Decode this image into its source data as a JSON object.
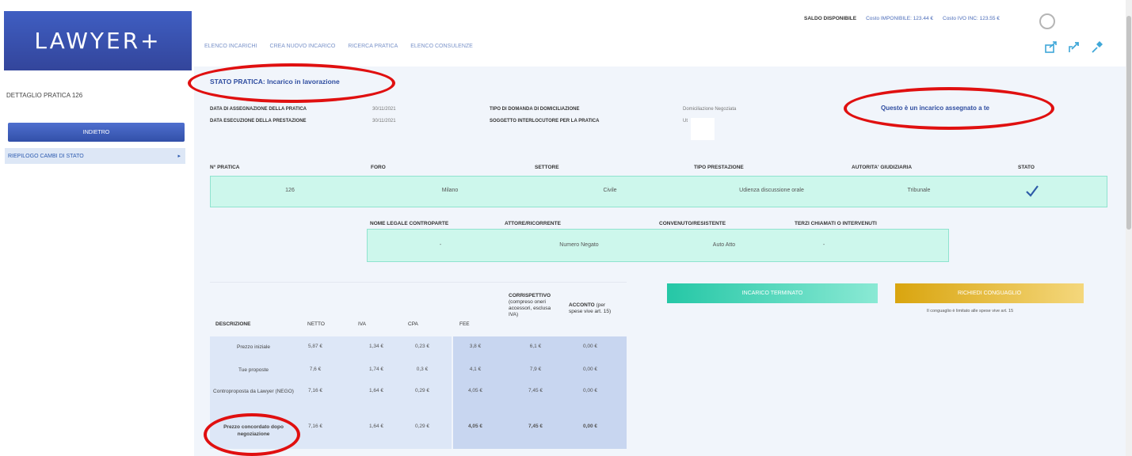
{
  "app": {
    "logo_text": "LAWYER+"
  },
  "sidebar": {
    "title": "DETTAGLIO PRATICA 126",
    "back_button": "INDIETRO",
    "item_label": "RIEPILOGO CAMBI DI STATO",
    "item_chevron": "▸"
  },
  "topnav": [
    "ELENCO INCARICHI",
    "CREA NUOVO INCARICO",
    "RICERCA PRATICA",
    "ELENCO CONSULENZE"
  ],
  "balance": {
    "label": "SALDO DISPONIBILE",
    "tax_label": "Costo IMPONIBILE: 123.44 €",
    "total_label": "Costo IVO INC: 123.55 €"
  },
  "status": {
    "title": "STATO PRATICA: Incarico in lavorazione",
    "assigned": "Questo è un incarico assegnato a te"
  },
  "info": {
    "date_label": "DATA DI ASSEGNAZIONE DELLA PRATICA",
    "date_value": "30/11/2021",
    "exec_label": "DATA ESECUZIONE DELLA PRESTAZIONE",
    "exec_value": "30/11/2021",
    "request_label": "TIPO DI DOMANDA DI DOMICILIAZIONE",
    "request_value": "Domiciliazione Negoziata",
    "subject_label": "SOGGETTO INTERLOCUTORE PER LA PRATICA",
    "subject_value": "Ut"
  },
  "case_table": {
    "headers": [
      "N° PRATICA",
      "FORO",
      "SETTORE",
      "TIPO PRESTAZIONE",
      "AUTORITA' GIUDIZIARIA",
      "STATO"
    ],
    "row": [
      "126",
      "Milano",
      "Civile",
      "Udienza discussione orale",
      "Tribunale",
      "✓"
    ]
  },
  "parties_table": {
    "headers": [
      "NOME LEGALE CONTROPARTE",
      "ATTORE/RICORRENTE",
      "CONVENUTO/RESISTENTE",
      "TERZI CHIAMATI O INTERVENUTI"
    ],
    "row": [
      "-",
      "Numero Negato",
      "Auto Atto",
      "-"
    ]
  },
  "actions": {
    "completed_button": "INCARICO TERMINATO",
    "conguaglio_button": "RICHIEDI CONGUAGLIO",
    "conguaglio_note": "Il conguaglio è limitato alle spese vive art. 15"
  },
  "price_table": {
    "headers": {
      "descrizione": "DESCRIZIONE",
      "netto": "NETTO",
      "iva": "IVA",
      "cpa": "CPA",
      "fee": "FEE",
      "corrispettivo_title": "CORRISPETTIVO",
      "corrispettivo_sub": "(compreso oneri accessori, esclusa IVA)",
      "acconto_title": "ACCONTO",
      "acconto_sub": "(per spese vive art. 15)"
    },
    "rows": [
      {
        "desc": "Prezzo iniziale",
        "netto": "5,87 €",
        "iva": "1,34 €",
        "cpa": "0,23 €",
        "fee": "3,8 €",
        "corr": "6,1 €",
        "acc": "0,00 €"
      },
      {
        "desc": "Tue proposte",
        "netto": "7,6 €",
        "iva": "1,74 €",
        "cpa": "0,3 €",
        "fee": "4,1 €",
        "corr": "7,9 €",
        "acc": "0,00 €"
      },
      {
        "desc": "Controproposta da Lawyer (NEGO)",
        "netto": "7,16 €",
        "iva": "1,64 €",
        "cpa": "0,29 €",
        "fee": "4,05 €",
        "corr": "7,45 €",
        "acc": "0,00 €"
      },
      {
        "desc": "Prezzo concordato dopo negoziazione",
        "netto": "7,16 €",
        "iva": "1,64 €",
        "cpa": "0,29 €",
        "fee": "4,05 €",
        "corr": "7,45 €",
        "acc": "0,00 €"
      }
    ]
  },
  "colors": {
    "brand_blue": "#33459b",
    "annotation_red": "#e01010",
    "success_teal": "#25c7a6",
    "gold": "#d9a50f"
  }
}
